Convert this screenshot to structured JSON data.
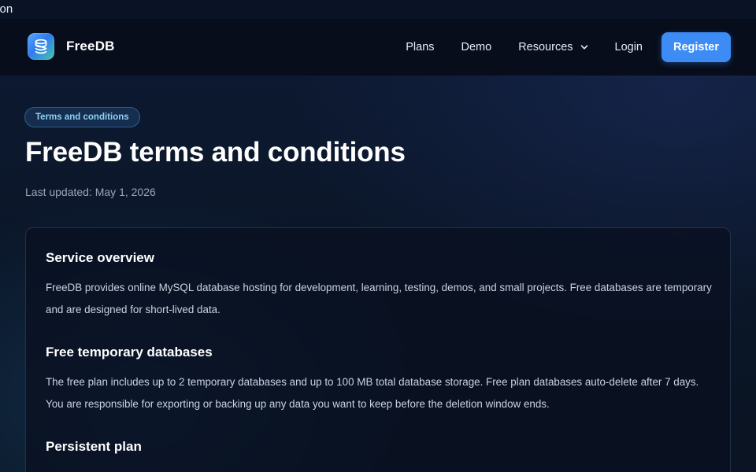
{
  "browser_fragment": "tion",
  "brand": {
    "name": "FreeDB",
    "logo_icon": "database-stack-icon"
  },
  "nav": {
    "links": [
      "Plans",
      "Demo",
      "Resources",
      "Login"
    ],
    "register_label": "Register"
  },
  "colors": {
    "accent": "#3d8bf5",
    "badge_text": "#8fd0f5",
    "background": "#0b1324"
  },
  "hero": {
    "badge": "Terms and conditions",
    "title": "FreeDB terms and conditions",
    "updated": "Last updated: May 1, 2026"
  },
  "sections": [
    {
      "heading": "Service overview",
      "body": "FreeDB provides online MySQL database hosting for development, learning, testing, demos, and small projects. Free databases are temporary and are designed for short-lived data."
    },
    {
      "heading": "Free temporary databases",
      "body": "The free plan includes up to 2 temporary databases and up to 100 MB total database storage. Free plan databases auto-delete after 7 days. You are responsible for exporting or backing up any data you want to keep before the deletion window ends."
    },
    {
      "heading": "Persistent plan",
      "body": ""
    }
  ]
}
